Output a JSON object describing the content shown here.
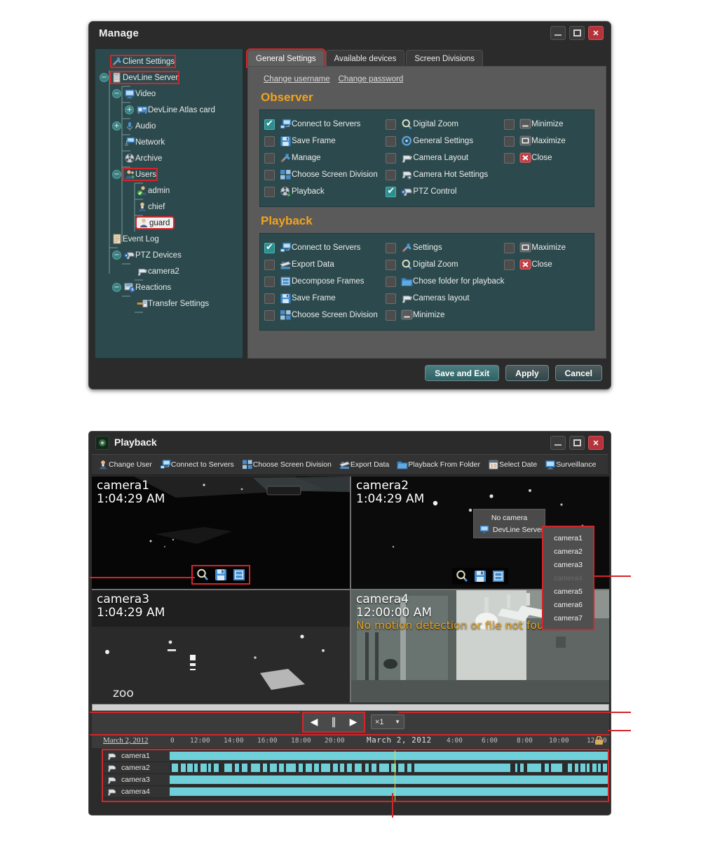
{
  "manage_window": {
    "title": "Manage",
    "window_buttons": {
      "minimize": "minimize-icon",
      "maximize": "maximize-icon",
      "close": "✕"
    },
    "tree": [
      {
        "label": "Client Settings",
        "icon": "tools-icon",
        "depth": 0,
        "expander": "",
        "highlight": "red"
      },
      {
        "label": "DevLine Server",
        "icon": "server-icon",
        "depth": 0,
        "expander": "minus",
        "highlight": "red"
      },
      {
        "label": "Video",
        "icon": "monitor-icon",
        "depth": 1,
        "expander": "minus",
        "highlight": "none"
      },
      {
        "label": "DevLine Atlas card",
        "icon": "card-icon",
        "depth": 2,
        "expander": "plus",
        "highlight": "none"
      },
      {
        "label": "Audio",
        "icon": "mic-icon",
        "depth": 1,
        "expander": "plus",
        "highlight": "none"
      },
      {
        "label": "Network",
        "icon": "network-icon",
        "depth": 1,
        "expander": "",
        "highlight": "none"
      },
      {
        "label": "Archive",
        "icon": "film-icon",
        "depth": 1,
        "expander": "",
        "highlight": "none"
      },
      {
        "label": "Users",
        "icon": "users-icon",
        "depth": 1,
        "expander": "minus",
        "highlight": "red"
      },
      {
        "label": "admin",
        "icon": "user-ok-icon",
        "depth": 2,
        "expander": "",
        "highlight": "none"
      },
      {
        "label": "chief",
        "icon": "user-icon",
        "depth": 2,
        "expander": "",
        "highlight": "none"
      },
      {
        "label": "guard",
        "icon": "user-icon",
        "depth": 2,
        "expander": "",
        "highlight": "selected"
      },
      {
        "label": "Event Log",
        "icon": "log-icon",
        "depth": 0,
        "expander": "",
        "highlight": "none"
      },
      {
        "label": "PTZ Devices",
        "icon": "ptz-icon",
        "depth": 1,
        "expander": "minus",
        "highlight": "none"
      },
      {
        "label": "camera2",
        "icon": "camera-icon",
        "depth": 2,
        "expander": "",
        "highlight": "none"
      },
      {
        "label": "Reactions",
        "icon": "reactions-icon",
        "depth": 1,
        "expander": "minus",
        "highlight": "none"
      },
      {
        "label": "Transfer Settings",
        "icon": "transfer-icon",
        "depth": 2,
        "expander": "",
        "highlight": "none"
      }
    ],
    "tabs": [
      {
        "label": "General Settings",
        "active": true
      },
      {
        "label": "Available devices",
        "active": false
      },
      {
        "label": "Screen Divisions",
        "active": false
      }
    ],
    "links": [
      "Change username",
      "Change password"
    ],
    "observer": {
      "title": "Observer",
      "col1": [
        {
          "label": "Connect to Servers",
          "checked": true,
          "icon": "connect-icon"
        },
        {
          "label": "Save Frame",
          "checked": false,
          "icon": "floppy-icon"
        },
        {
          "label": "Manage",
          "checked": false,
          "icon": "tools-icon"
        },
        {
          "label": "Choose Screen Division",
          "checked": false,
          "icon": "grid-icon"
        },
        {
          "label": "Playback",
          "checked": false,
          "icon": "film-play-icon"
        }
      ],
      "col2": [
        {
          "label": "Digital Zoom",
          "checked": false,
          "icon": "magnifier-icon"
        },
        {
          "label": "General Settings",
          "checked": false,
          "icon": "gear-icon"
        },
        {
          "label": "Camera Layout",
          "checked": false,
          "icon": "camera-icon"
        },
        {
          "label": "Camera Hot Settings",
          "checked": false,
          "icon": "camera-gear-icon"
        },
        {
          "label": "PTZ Control",
          "checked": true,
          "icon": "ptz-icon"
        }
      ],
      "col3": [
        {
          "label": "Minimize",
          "checked": false,
          "icon": "minimize-icon"
        },
        {
          "label": "Maximize",
          "checked": false,
          "icon": "maximize-icon"
        },
        {
          "label": "Close",
          "checked": false,
          "icon": "close-icon"
        }
      ]
    },
    "playback_perm": {
      "title": "Playback",
      "col1": [
        {
          "label": "Connect to Servers",
          "checked": true,
          "icon": "connect-icon"
        },
        {
          "label": "Export Data",
          "checked": false,
          "icon": "export-icon"
        },
        {
          "label": "Decompose Frames",
          "checked": false,
          "icon": "frames-icon"
        },
        {
          "label": "Save Frame",
          "checked": false,
          "icon": "floppy-icon"
        },
        {
          "label": "Choose Screen Division",
          "checked": false,
          "icon": "grid-icon"
        }
      ],
      "col2": [
        {
          "label": "Settings",
          "checked": false,
          "icon": "tools-icon"
        },
        {
          "label": "Digital Zoom",
          "checked": false,
          "icon": "magnifier-icon"
        },
        {
          "label": "Chose folder for playback",
          "checked": false,
          "icon": "folder-icon"
        },
        {
          "label": "Cameras layout",
          "checked": false,
          "icon": "camera-icon"
        },
        {
          "label": "Minimize",
          "checked": false,
          "icon": "minimize-icon"
        }
      ],
      "col3": [
        {
          "label": "Maximize",
          "checked": false,
          "icon": "maximize-icon"
        },
        {
          "label": "Close",
          "checked": false,
          "icon": "close-icon"
        }
      ]
    },
    "footer_buttons": [
      {
        "label": "Save and Exit",
        "style": "teal"
      },
      {
        "label": "Apply",
        "style": "plain"
      },
      {
        "label": "Cancel",
        "style": "plain"
      }
    ]
  },
  "playback_window": {
    "title": "Playback",
    "toolbar": [
      {
        "label": "Change User",
        "icon": "user-icon"
      },
      {
        "label": "Connect to Servers",
        "icon": "connect-icon"
      },
      {
        "label": "Choose Screen Division",
        "icon": "grid-icon"
      },
      {
        "label": "Export Data",
        "icon": "export-icon"
      },
      {
        "label": "Playback From Folder",
        "icon": "folder-icon"
      },
      {
        "label": "Select Date",
        "icon": "calendar-icon"
      },
      {
        "label": "Surveillance",
        "icon": "monitor-icon"
      }
    ],
    "cameras": [
      {
        "name": "camera1",
        "time": "1:04:29 AM",
        "warning": ""
      },
      {
        "name": "camera2",
        "time": "1:04:29 AM",
        "warning": ""
      },
      {
        "name": "camera3",
        "time": "1:04:29 AM",
        "warning": ""
      },
      {
        "name": "camera4",
        "time": "12:00:00 AM",
        "warning": "No motion detection or file not found"
      }
    ],
    "cam_tools": [
      "magnifier-icon",
      "floppy-icon",
      "frames-icon"
    ],
    "context_menu": {
      "no_camera": "No camera",
      "server": "DevLine Server",
      "submenu_arrow": "▸"
    },
    "camera_list": [
      {
        "label": "camera1",
        "enabled": true
      },
      {
        "label": "camera2",
        "enabled": true
      },
      {
        "label": "camera3",
        "enabled": true
      },
      {
        "label": "camera4",
        "enabled": false
      },
      {
        "label": "camera5",
        "enabled": true
      },
      {
        "label": "camera6",
        "enabled": true
      },
      {
        "label": "camera7",
        "enabled": true
      }
    ],
    "transport": {
      "rewind": "◀",
      "pause": "‖",
      "play": "▶",
      "speed": "×1",
      "speed_arrow": "▼"
    },
    "timeline": {
      "date_left": "March 2, 2012",
      "date_center": "March 2, 2012",
      "ticks": [
        "0",
        "12:00",
        "14:00",
        "16:00",
        "18:00",
        "20:00",
        "4:00",
        "6:00",
        "8:00",
        "10:00",
        "12:00"
      ],
      "rows": [
        {
          "camera": "camera1"
        },
        {
          "camera": "camera2"
        },
        {
          "camera": "camera3"
        },
        {
          "camera": "camera4"
        }
      ]
    }
  },
  "colors": {
    "accent_red": "#d4252a",
    "panel_teal": "#2c4a4d",
    "section_orange": "#f0a41e",
    "timeline_cyan": "#6fd0da",
    "cursor_yellow": "#e3e03c"
  }
}
